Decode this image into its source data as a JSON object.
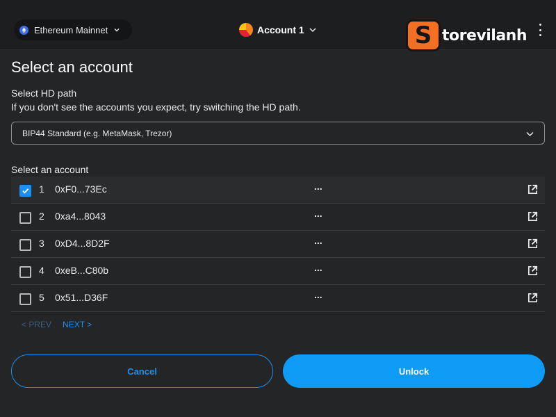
{
  "header": {
    "network_label": "Ethereum Mainnet",
    "account_label": "Account 1",
    "brand_badge": "S",
    "brand_text": "torevilanh"
  },
  "page": {
    "title": "Select an account",
    "hd_path_label": "Select HD path",
    "hd_path_hint": "If you don't see the accounts you expect, try switching the HD path.",
    "hd_path_selected": "BIP44 Standard (e.g. MetaMask, Trezor)",
    "accounts_label": "Select an account"
  },
  "accounts": [
    {
      "index": "1",
      "address": "0xF0...73Ec",
      "balance": "...",
      "checked": true
    },
    {
      "index": "2",
      "address": "0xa4...8043",
      "balance": "...",
      "checked": false
    },
    {
      "index": "3",
      "address": "0xD4...8D2F",
      "balance": "...",
      "checked": false
    },
    {
      "index": "4",
      "address": "0xeB...C80b",
      "balance": "...",
      "checked": false
    },
    {
      "index": "5",
      "address": "0x51...D36F",
      "balance": "...",
      "checked": false
    }
  ],
  "pager": {
    "prev_label": "< PREV",
    "next_label": "NEXT >"
  },
  "buttons": {
    "cancel_label": "Cancel",
    "unlock_label": "Unlock"
  },
  "colors": {
    "accent": "#1d8ff0",
    "background": "#242527",
    "header": "#1d1e20",
    "brand": "#f36f21"
  }
}
